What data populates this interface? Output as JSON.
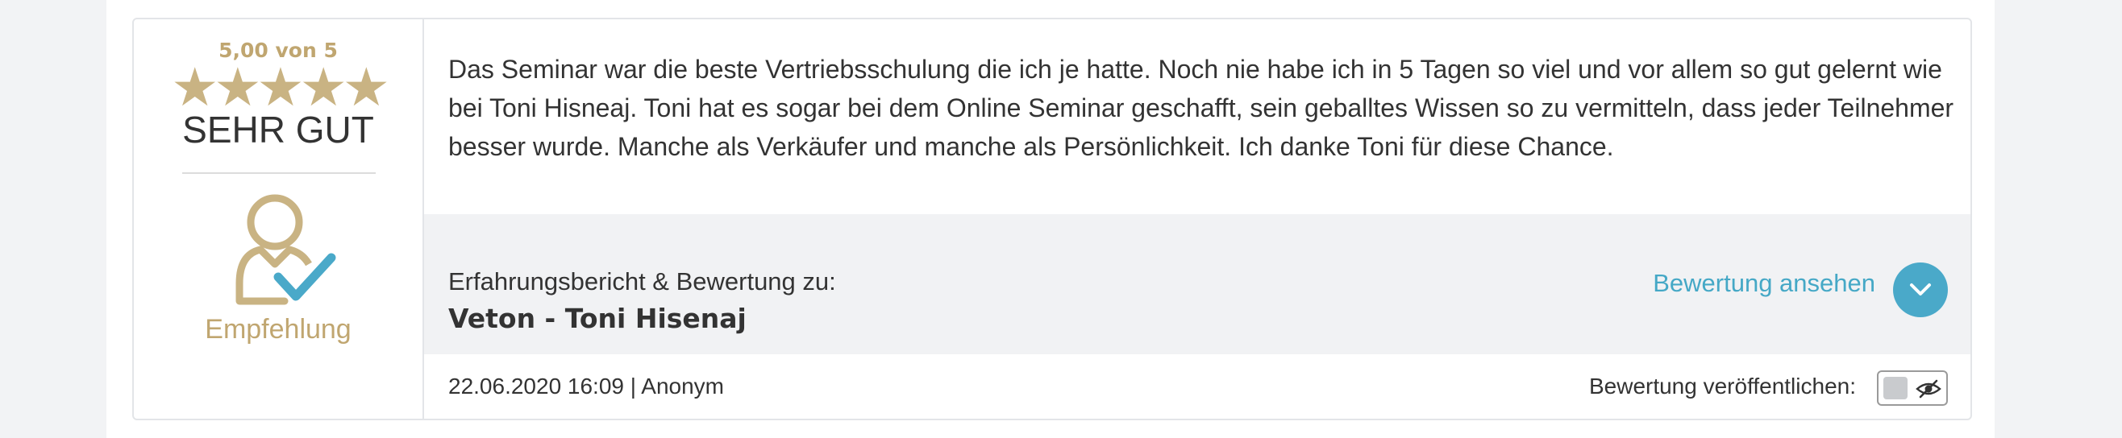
{
  "rating": {
    "score_text": "5,00 von 5",
    "stars": 5,
    "stars_glyphs": "★★★★★",
    "grade": "SEHR GUT",
    "recommendation": "Empfehlung"
  },
  "review": {
    "text": "Das Seminar war die beste Vertriebsschulung die ich je hatte. Noch nie habe ich in 5 Tagen so viel und vor allem so gut gelernt wie bei Toni Hisneaj. Toni hat es sogar bei dem Online Seminar geschafft, sein geballtes Wissen so zu vermitteln, dass jeder Teilnehmer besser wurde. Manche als Verkäufer und manche als Persönlichkeit. Ich danke Toni für diese Chance.",
    "experience_label": "Erfahrungsbericht & Bewertung zu:",
    "experience_target": "Veton - Toni Hisenaj",
    "view_link": "Bewertung ansehen",
    "meta": "22.06.2020 16:09 | Anonym",
    "publish_label": "Bewertung veröffentlichen:"
  },
  "colors": {
    "gold": "#c0a670",
    "accent": "#45a8c6",
    "check": "#4aa9c9"
  },
  "icons": {
    "recommendation": "person-check-icon",
    "expand": "chevron-down-icon",
    "visibility": "eye-slash-icon"
  }
}
